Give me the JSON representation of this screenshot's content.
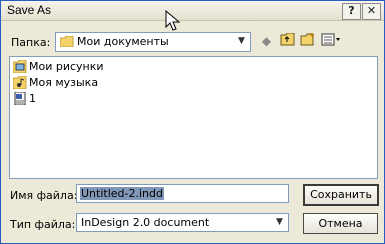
{
  "window": {
    "title": "Save As",
    "help_glyph": "?",
    "close_glyph": "✕"
  },
  "lookin": {
    "label": "Папка:",
    "value": "Мои документы"
  },
  "files": [
    {
      "name": "Мои рисунки",
      "icon": "pictures-folder-icon"
    },
    {
      "name": "Моя музыка",
      "icon": "music-folder-icon"
    },
    {
      "name": "1",
      "icon": "document-icon"
    }
  ],
  "filename": {
    "label": "Имя файла:",
    "value": "Untitled-2.indd"
  },
  "filetype": {
    "label": "Тип файла:",
    "value": "InDesign 2.0 document"
  },
  "buttons": {
    "save": "Сохранить",
    "cancel": "Отмена"
  },
  "colors": {
    "title_border": "#2a5bbf",
    "dialog_bg": "#ece9d8",
    "field_border": "#7f9db9",
    "selection": "#8197b8"
  }
}
